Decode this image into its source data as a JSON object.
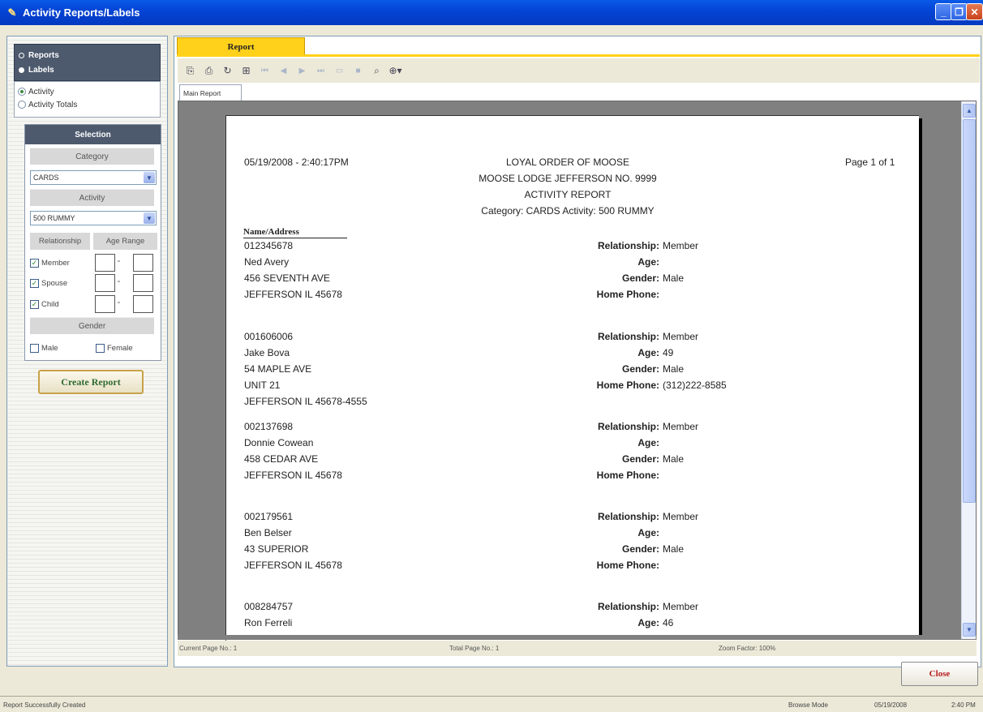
{
  "window": {
    "title": "Activity Reports/Labels",
    "icon": "pencil-icon",
    "controls": [
      "minimize",
      "maximize",
      "close"
    ]
  },
  "left": {
    "mode": {
      "reports": "Reports",
      "labels": "Labels",
      "selected": "Labels"
    },
    "report_types": [
      {
        "label": "Activity",
        "selected": true
      },
      {
        "label": "Activity Totals",
        "selected": false
      }
    ],
    "selection": {
      "header": "Selection",
      "category_label": "Category",
      "category_value": "CARDS",
      "activity_label": "Activity",
      "activity_value": "500 RUMMY",
      "relationship_label": "Relationship",
      "age_range_label": "Age Range",
      "relationships": [
        {
          "label": "Member",
          "checked": true,
          "age_from": "",
          "age_to": ""
        },
        {
          "label": "Spouse",
          "checked": true,
          "age_from": "",
          "age_to": ""
        },
        {
          "label": "Child",
          "checked": true,
          "age_from": "",
          "age_to": ""
        }
      ],
      "gender_label": "Gender",
      "genders": [
        {
          "label": "Male",
          "checked": false
        },
        {
          "label": "Female",
          "checked": false
        }
      ]
    },
    "create_button": "Create Report"
  },
  "right": {
    "tab": "Report",
    "subtab": "Main Report",
    "toolbar_icons": [
      "export-icon",
      "print-icon",
      "refresh-icon",
      "tree-icon",
      "first-page-icon",
      "prev-page-icon",
      "next-page-icon",
      "last-page-icon",
      "page-icon",
      "stop-icon",
      "search-icon",
      "zoom-icon"
    ],
    "status": {
      "current_page": "Current Page No.: 1",
      "total_page": "Total Page No.: 1",
      "zoom": "Zoom Factor: 100%"
    },
    "close_button": "Close"
  },
  "report": {
    "datetime": "05/19/2008 - 2:40:17PM",
    "org": "LOYAL ORDER OF MOOSE",
    "lodge": "MOOSE LODGE JEFFERSON NO. 9999",
    "title": "ACTIVITY REPORT",
    "criteria": "Category: CARDS  Activity: 500 RUMMY",
    "page": "Page 1 of 1",
    "col_header": "Name/Address",
    "labels": {
      "relationship": "Relationship:",
      "age": "Age:",
      "gender": "Gender:",
      "phone": "Home Phone:"
    },
    "members": [
      {
        "id": "012345678",
        "name": "Ned Avery",
        "addr1": "456 SEVENTH AVE",
        "addr2": "JEFFERSON IL 45678",
        "addr3": "",
        "relationship": "Member",
        "age": "",
        "gender": "Male",
        "phone": ""
      },
      {
        "id": "001606006",
        "name": "Jake Bova",
        "addr1": "54 MAPLE AVE",
        "addr2": "UNIT 21",
        "addr3": "JEFFERSON IL 45678-4555",
        "relationship": "Member",
        "age": "49",
        "gender": "Male",
        "phone": "(312)222-8585"
      },
      {
        "id": "002137698",
        "name": "Donnie Cowean",
        "addr1": "458 CEDAR AVE",
        "addr2": "JEFFERSON IL 45678",
        "addr3": "",
        "relationship": "Member",
        "age": "",
        "gender": "Male",
        "phone": ""
      },
      {
        "id": "002179561",
        "name": "Ben Belser",
        "addr1": "43 SUPERIOR",
        "addr2": "JEFFERSON IL 45678",
        "addr3": "",
        "relationship": "Member",
        "age": "",
        "gender": "Male",
        "phone": ""
      },
      {
        "id": "008284757",
        "name": "Ron Ferreli",
        "addr1": "",
        "addr2": "",
        "addr3": "",
        "relationship": "Member",
        "age": "46",
        "gender": "",
        "phone": ""
      }
    ]
  },
  "statusbar": {
    "message": "Report Successfully Created",
    "mode": "Browse Mode",
    "date": "05/19/2008",
    "time": "2:40 PM"
  }
}
